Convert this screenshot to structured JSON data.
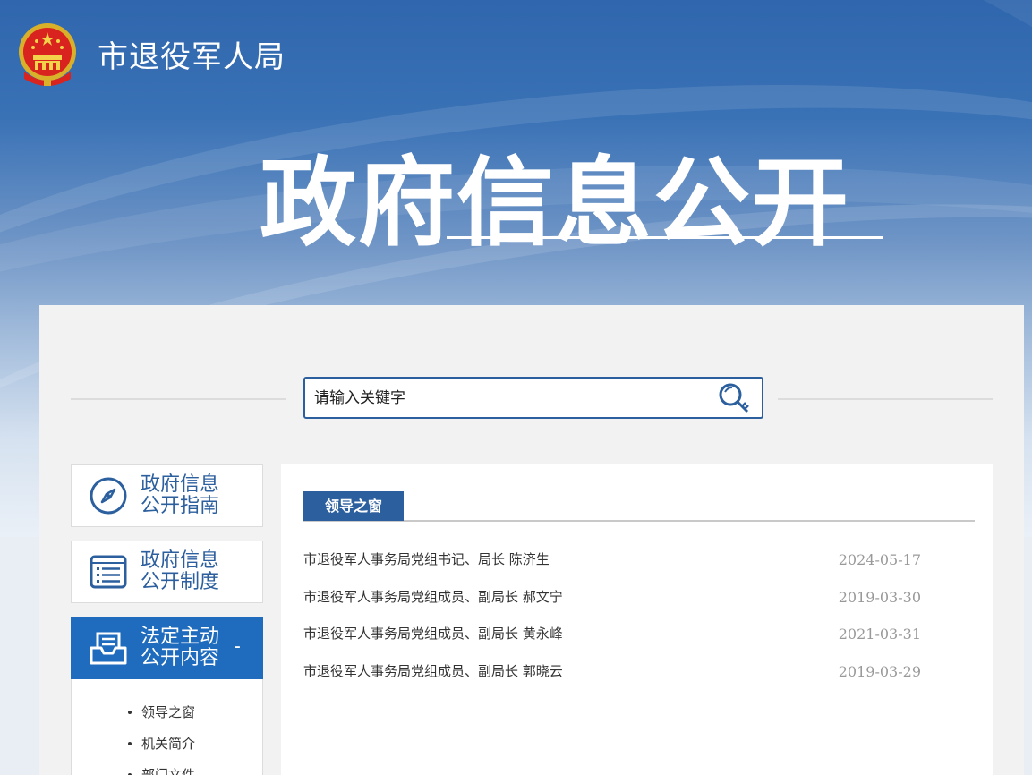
{
  "header": {
    "site_title": "市退役军人局",
    "hero_title": "政府信息公开"
  },
  "search": {
    "placeholder": "请输入关键字",
    "icon": "search-key-icon"
  },
  "sidebar": {
    "items": [
      {
        "label_line1": "政府信息",
        "label_line2": "公开指南",
        "icon": "compass-icon"
      },
      {
        "label_line1": "政府信息",
        "label_line2": "公开制度",
        "icon": "document-list-icon"
      },
      {
        "label_line1": "法定主动",
        "label_line2": "公开内容",
        "icon": "inbox-icon",
        "toggle": "-"
      }
    ],
    "submenu": [
      "领导之窗",
      "机关简介",
      "部门文件"
    ]
  },
  "content": {
    "tab_label": "领导之窗",
    "rows": [
      {
        "title": "市退役军人事务局党组书记、局长 陈济生",
        "date": "2024-05-17"
      },
      {
        "title": "市退役军人事务局党组成员、副局长 郝文宁",
        "date": "2019-03-30"
      },
      {
        "title": "市退役军人事务局党组成员、副局长 黄永峰",
        "date": "2021-03-31"
      },
      {
        "title": "市退役军人事务局党组成员、副局长 郭晓云",
        "date": "2019-03-29"
      }
    ]
  },
  "colors": {
    "primary": "#2c5f9e",
    "active": "#1f6bbd",
    "date": "#999999"
  }
}
